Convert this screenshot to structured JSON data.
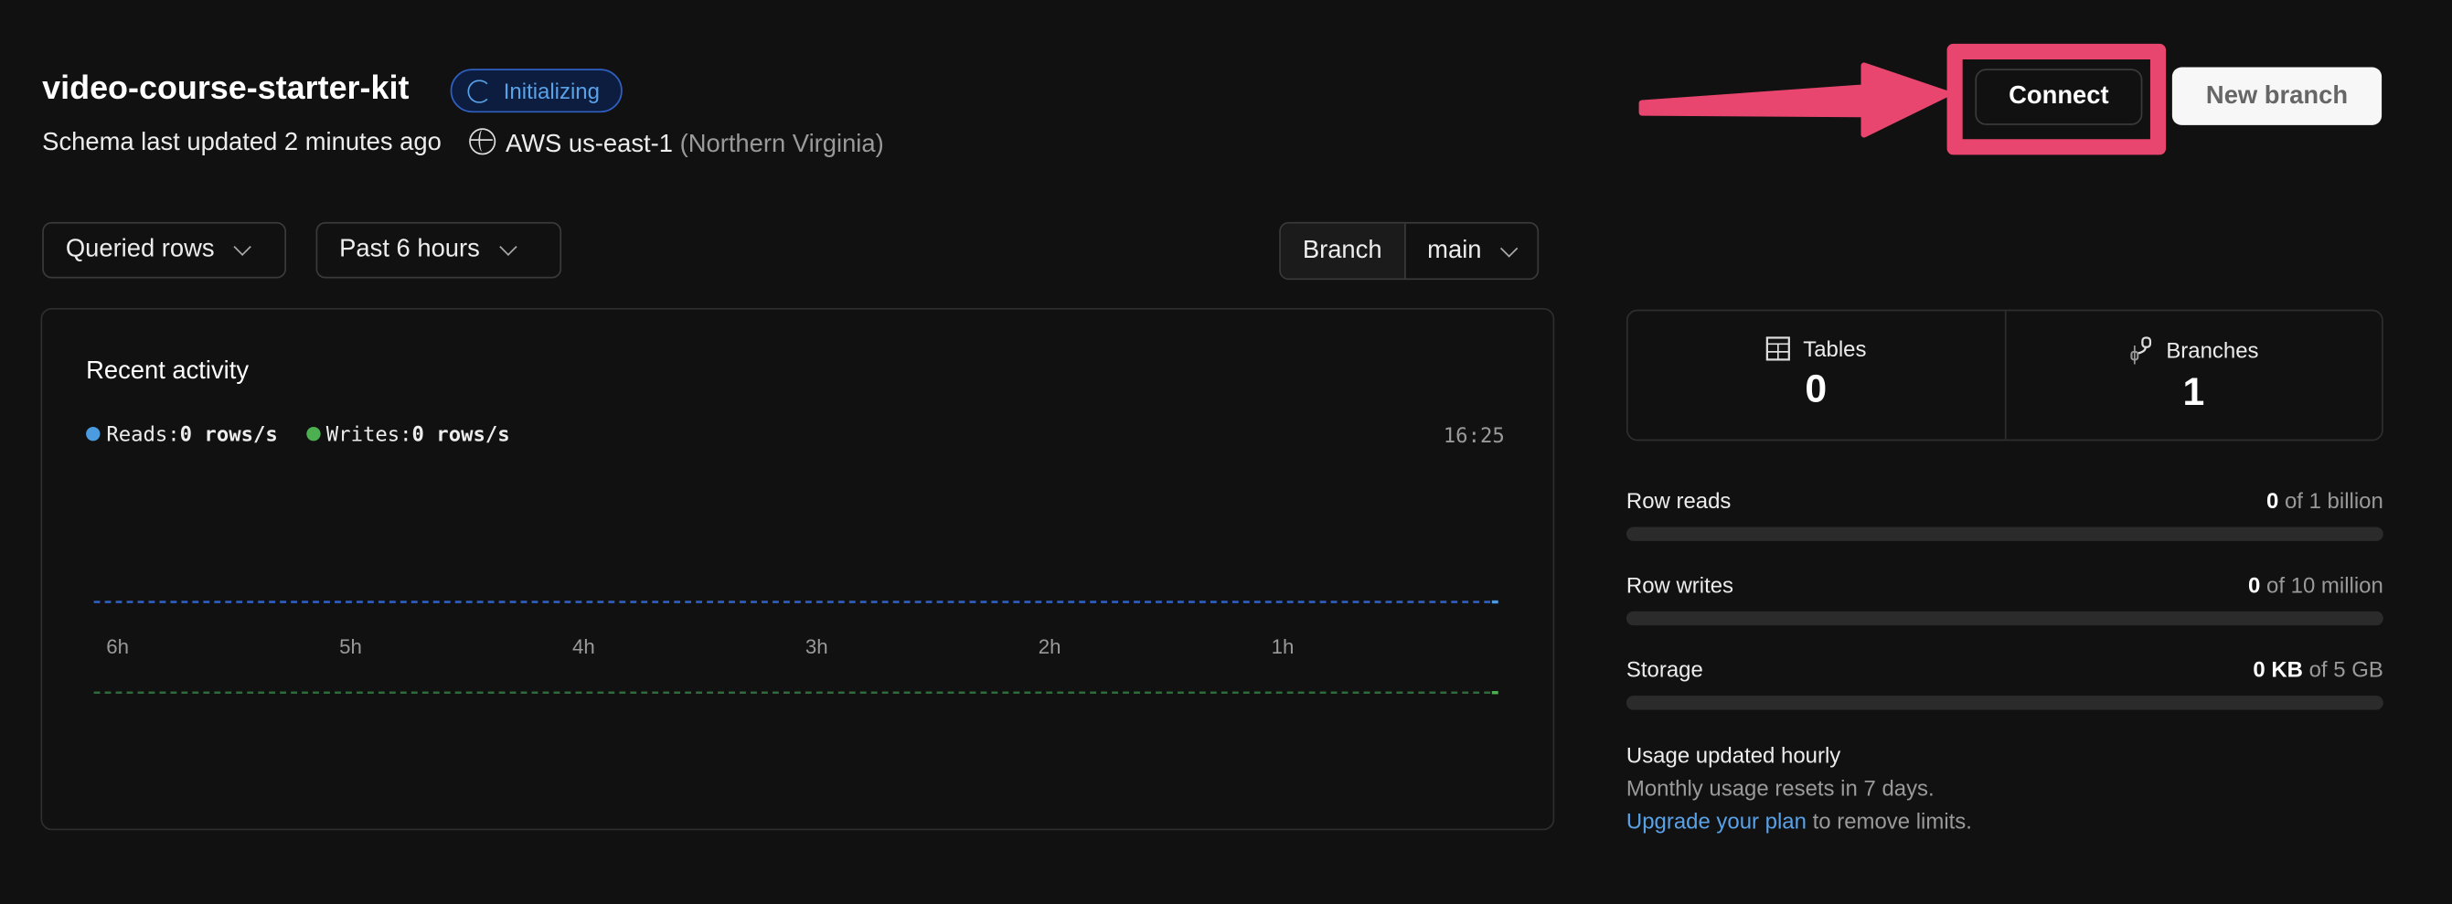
{
  "header": {
    "db_name": "video-course-starter-kit",
    "status": "Initializing",
    "schema_updated": "Schema last updated 2 minutes ago",
    "region": "AWS us-east-1",
    "region_detail": "(Northern Virginia)",
    "connect_label": "Connect",
    "new_branch_label": "New branch"
  },
  "filters": {
    "metric": "Queried rows",
    "range": "Past 6 hours",
    "branch_label": "Branch",
    "branch_value": "main"
  },
  "activity": {
    "title": "Recent activity",
    "reads_label": "Reads:",
    "reads_value": "0 rows/s",
    "writes_label": "Writes:",
    "writes_value": "0 rows/s",
    "time": "16:25"
  },
  "chart_data": {
    "type": "line",
    "x": [
      "6h",
      "5h",
      "4h",
      "3h",
      "2h",
      "1h"
    ],
    "series": [
      {
        "name": "Reads",
        "unit": "rows/s",
        "values": [
          0,
          0,
          0,
          0,
          0,
          0
        ],
        "color": "#2f5fc0"
      },
      {
        "name": "Writes",
        "unit": "rows/s",
        "values": [
          0,
          0,
          0,
          0,
          0,
          0
        ],
        "color": "#2f6b3a"
      }
    ]
  },
  "stats": {
    "tables_label": "Tables",
    "tables_value": "0",
    "branches_label": "Branches",
    "branches_value": "1"
  },
  "usage": [
    {
      "label": "Row reads",
      "value": "0",
      "limit": "of 1 billion",
      "fraction": 0
    },
    {
      "label": "Row writes",
      "value": "0",
      "limit": "of 10 million",
      "fraction": 0
    },
    {
      "label": "Storage",
      "value": "0 KB",
      "limit": "of 5 GB",
      "fraction": 0
    }
  ],
  "footer": {
    "title": "Usage updated hourly",
    "reset": "Monthly usage resets in 7 days.",
    "upgrade_link": "Upgrade your plan",
    "upgrade_rest": "to remove limits."
  },
  "colors": {
    "accent": "#5aa2e8",
    "reads": "#4a9be0",
    "writes": "#4caf50",
    "highlight": "#e8466e"
  }
}
